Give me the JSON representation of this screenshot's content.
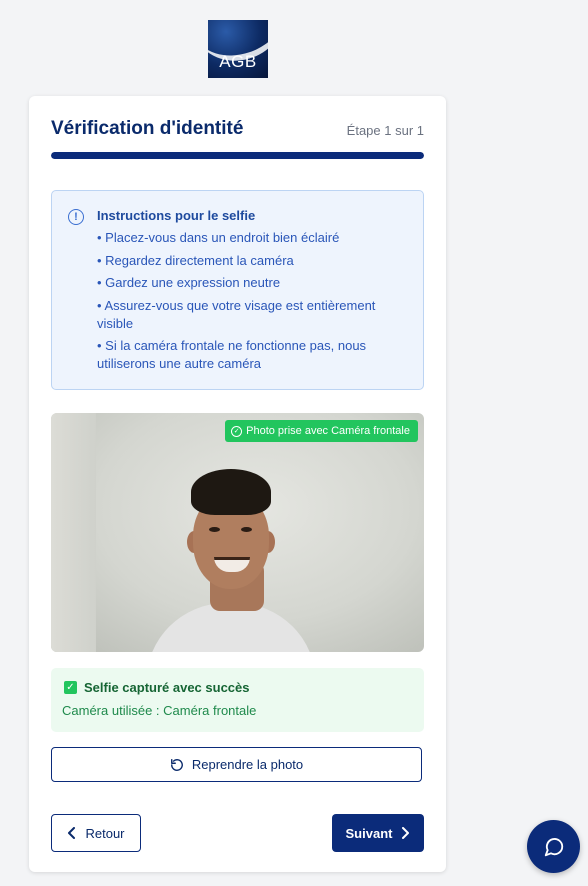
{
  "logo": {
    "text": "AGB"
  },
  "header": {
    "title": "Vérification d'identité",
    "step": "Étape 1 sur 1",
    "progress": 1.0
  },
  "instructions": {
    "icon": "info-icon",
    "title": "Instructions pour le selfie",
    "items": [
      "• Placez-vous dans un endroit bien éclairé",
      "• Regardez directement la caméra",
      "• Gardez une expression neutre",
      "• Assurez-vous que votre visage est entièrement visible",
      "• Si la caméra frontale ne fonctionne pas, nous utiliserons une autre caméra"
    ]
  },
  "photo": {
    "badge": "Photo prise avec Caméra frontale"
  },
  "success": {
    "title": "Selfie capturé avec succès",
    "subtitle": "Caméra utilisée : Caméra frontale"
  },
  "buttons": {
    "retake": "Reprendre la photo",
    "back": "Retour",
    "next": "Suivant"
  },
  "colors": {
    "primary": "#0b2b7a",
    "success": "#22c55e",
    "info_bg": "#eef4fd"
  }
}
